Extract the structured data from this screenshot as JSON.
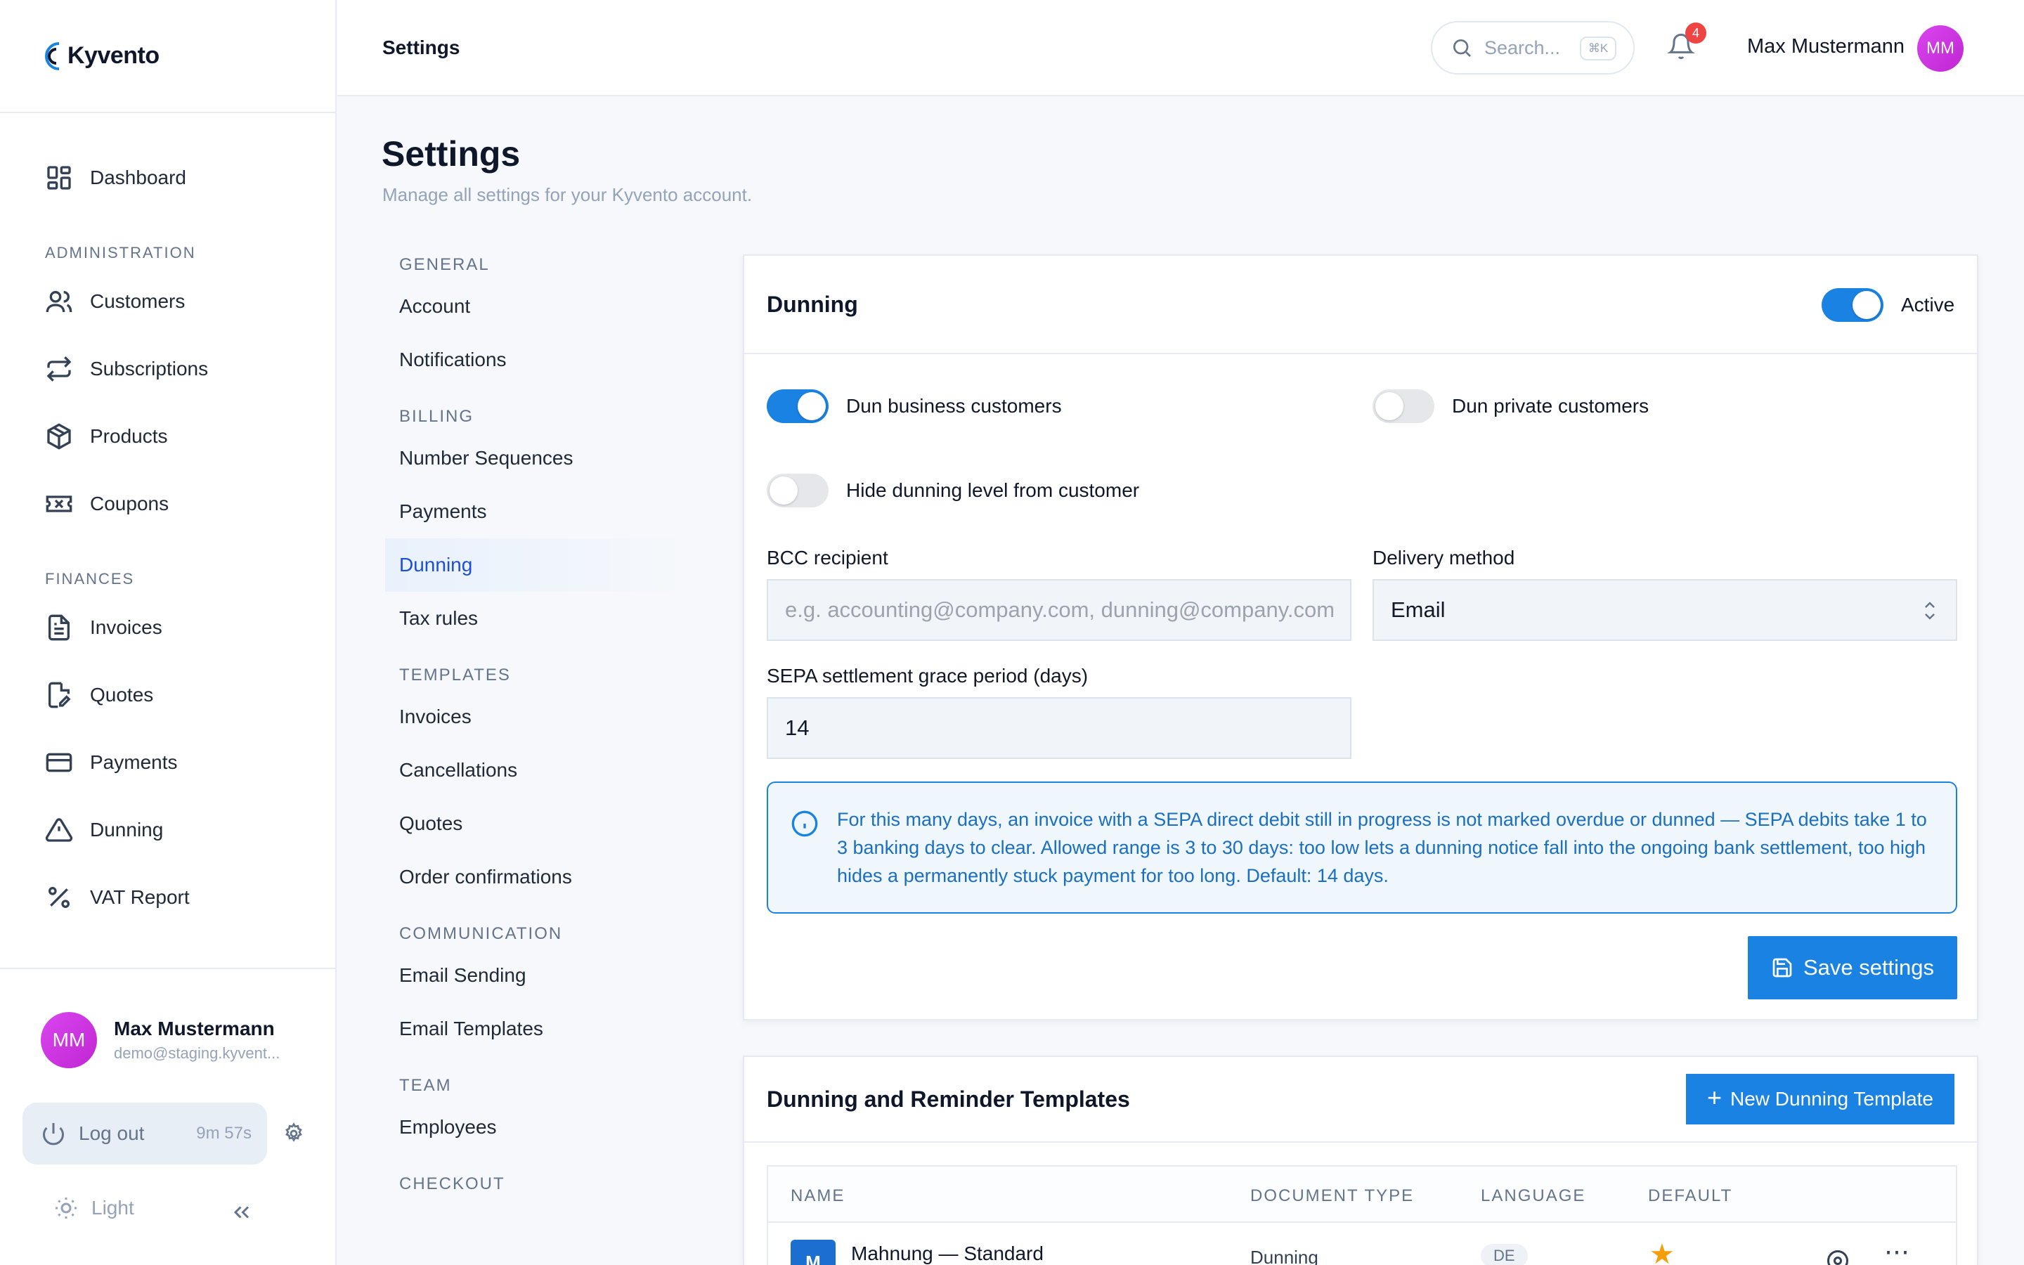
{
  "app": {
    "name": "Kyvento"
  },
  "sidebar": {
    "dashboard": "Dashboard",
    "sections": [
      {
        "title": "ADMINISTRATION",
        "items": [
          "Customers",
          "Subscriptions",
          "Products",
          "Coupons"
        ]
      },
      {
        "title": "FINANCES",
        "items": [
          "Invoices",
          "Quotes",
          "Payments",
          "Dunning",
          "VAT Report"
        ]
      }
    ],
    "user": {
      "initials": "MM",
      "name": "Max Mustermann",
      "email": "demo@staging.kyvent..."
    },
    "logout": {
      "label": "Log out",
      "timer": "9m 57s"
    },
    "theme": "Light"
  },
  "topbar": {
    "breadcrumb": "Settings",
    "search_placeholder": "Search...",
    "search_shortcut": "⌘K",
    "notification_count": "4",
    "user_name": "Max Mustermann",
    "user_initials": "MM"
  },
  "page": {
    "title": "Settings",
    "subtitle": "Manage all settings for your Kyvento account."
  },
  "settings_nav": [
    {
      "title": "GENERAL",
      "items": [
        "Account",
        "Notifications"
      ]
    },
    {
      "title": "BILLING",
      "items": [
        "Number Sequences",
        "Payments",
        "Dunning",
        "Tax rules"
      ]
    },
    {
      "title": "TEMPLATES",
      "items": [
        "Invoices",
        "Cancellations",
        "Quotes",
        "Order confirmations"
      ]
    },
    {
      "title": "COMMUNICATION",
      "items": [
        "Email Sending",
        "Email Templates"
      ]
    },
    {
      "title": "TEAM",
      "items": [
        "Employees"
      ]
    },
    {
      "title": "CHECKOUT",
      "items": []
    }
  ],
  "settings_nav_active": "Dunning",
  "dunning": {
    "title": "Dunning",
    "active_label": "Active",
    "active": true,
    "dun_business": {
      "label": "Dun business customers",
      "on": true
    },
    "dun_private": {
      "label": "Dun private customers",
      "on": false
    },
    "hide_level": {
      "label": "Hide dunning level from customer",
      "on": false
    },
    "bcc": {
      "label": "BCC recipient",
      "placeholder": "e.g. accounting@company.com, dunning@company.com",
      "value": ""
    },
    "delivery": {
      "label": "Delivery method",
      "value": "Email"
    },
    "grace": {
      "label": "SEPA settlement grace period (days)",
      "value": "14"
    },
    "info": "For this many days, an invoice with a SEPA direct debit still in progress is not marked overdue or dunned — SEPA debits take 1 to 3 banking days to clear. Allowed range is 3 to 30 days: too low lets a dunning notice fall into the ongoing bank settlement, too high hides a permanently stuck payment for too long. Default: 14 days.",
    "save_label": "Save settings"
  },
  "templates": {
    "title": "Dunning and Reminder Templates",
    "new_label": "New Dunning Template",
    "columns": [
      "NAME",
      "DOCUMENT TYPE",
      "LANGUAGE",
      "DEFAULT"
    ],
    "rows": [
      {
        "icon_letter": "M",
        "name": "Mahnung — Standard",
        "document_type": "Dunning",
        "language": "DE",
        "default": true
      }
    ]
  },
  "colors": {
    "accent": "#1a82e2",
    "avatar": "#d946ef",
    "badge": "#ef4444"
  }
}
